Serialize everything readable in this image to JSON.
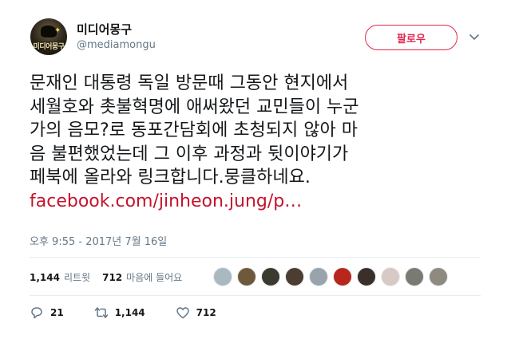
{
  "author": {
    "display_name": "미디어몽구",
    "handle": "@mediamongu",
    "avatar_text": "미디어몽구"
  },
  "follow_button": {
    "label": "팔로우"
  },
  "tweet": {
    "lines": [
      "문재인 대통령 독일 방문때 그동안 현지에서",
      "세월호와 촛불혁명에 애써왔던 교민들이 누군",
      "가의 음모?로 동포간담회에 초청되지 않아 마",
      "음 불편했었는데 그 이후 과정과 뒷이야기가",
      "페북에 올라와 링크합니다.뭉클하네요."
    ],
    "link": "facebook.com/jinheon.jung/p…",
    "timestamp": "오후 9:55 - 2017년 7월 16일"
  },
  "stats": {
    "retweets_count": "1,144",
    "retweets_label": "리트윗",
    "likes_count": "712",
    "likes_label": "마음에 들어요"
  },
  "likers": [
    {
      "icon": "default-avatar",
      "color": "#aab8c2"
    },
    {
      "icon": "avatar",
      "color": "#6e5a3a"
    },
    {
      "icon": "avatar",
      "color": "#3a3a2e"
    },
    {
      "icon": "avatar",
      "color": "#4b3d2f"
    },
    {
      "icon": "avatar",
      "color": "#9aa3ad"
    },
    {
      "icon": "avatar",
      "color": "#b8261c"
    },
    {
      "icon": "avatar",
      "color": "#3b2f2a"
    },
    {
      "icon": "avatar",
      "color": "#d9c9c4"
    },
    {
      "icon": "avatar",
      "color": "#7a7a72"
    },
    {
      "icon": "avatar",
      "color": "#8f8a80"
    }
  ],
  "actions": {
    "reply_count": "21",
    "retweet_count": "1,144",
    "like_count": "712"
  },
  "colors": {
    "accent": "#e2264d",
    "link": "#c4132c",
    "muted": "#657786",
    "text": "#14171a"
  }
}
